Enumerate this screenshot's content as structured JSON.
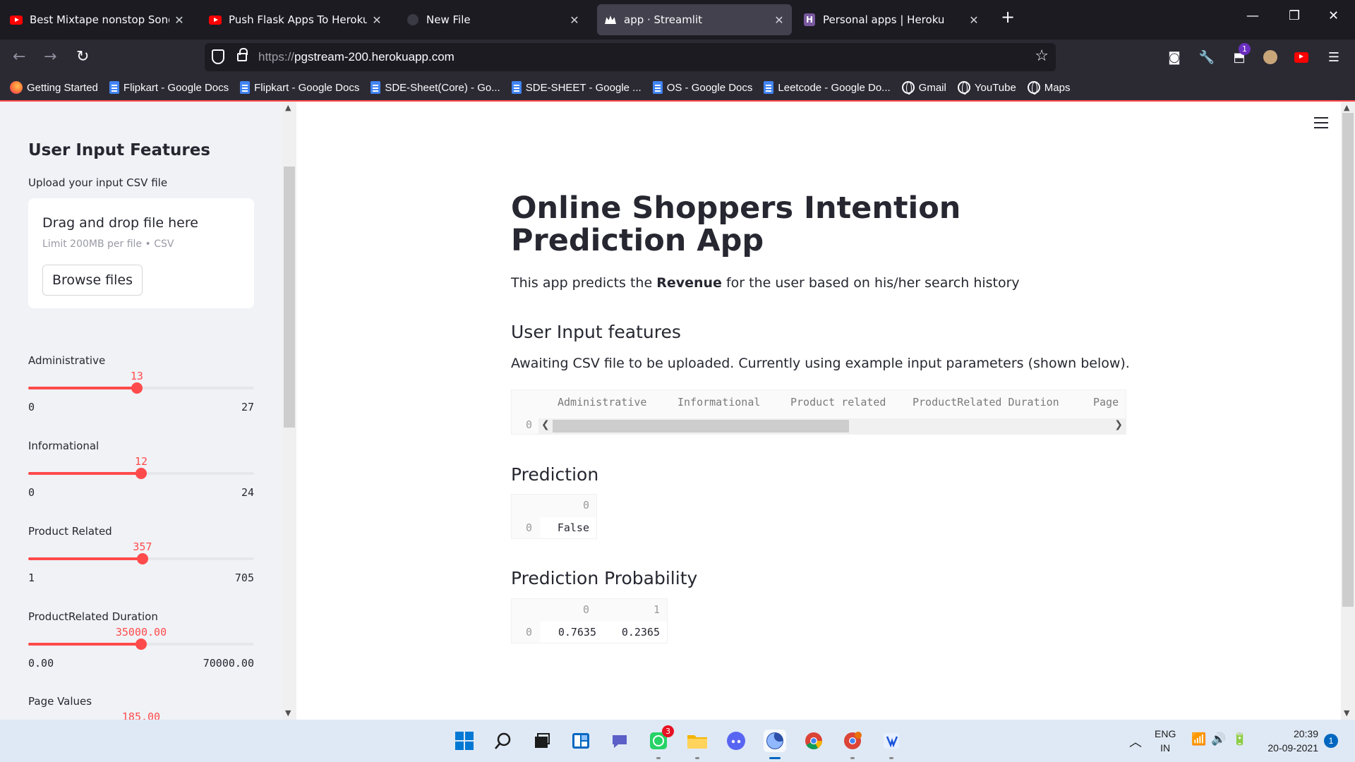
{
  "browser": {
    "tabs": [
      {
        "title": "Best Mixtape nonstop Songs | B",
        "icon": "youtube-icon",
        "active": false
      },
      {
        "title": "Push Flask Apps To Heroku For V",
        "icon": "youtube-icon",
        "active": false
      },
      {
        "title": "New File",
        "icon": "github-icon",
        "active": false
      },
      {
        "title": "app · Streamlit",
        "icon": "streamlit-icon",
        "active": true
      },
      {
        "title": "Personal apps | Heroku",
        "icon": "heroku-icon",
        "active": false
      }
    ],
    "url_protocol": "https://",
    "url_host": "pgstream-200.herokuapp.com",
    "bookmarks": [
      {
        "label": "Getting Started",
        "icon": "firefox-icon"
      },
      {
        "label": "Flipkart - Google Docs",
        "icon": "google-docs-icon"
      },
      {
        "label": "Flipkart - Google Docs",
        "icon": "google-docs-icon"
      },
      {
        "label": "SDE-Sheet(Core) - Go...",
        "icon": "google-docs-icon"
      },
      {
        "label": "SDE-SHEET - Google ...",
        "icon": "google-docs-icon"
      },
      {
        "label": "OS - Google Docs",
        "icon": "google-docs-icon"
      },
      {
        "label": "Leetcode - Google Do...",
        "icon": "google-docs-icon"
      },
      {
        "label": "Gmail",
        "icon": "globe-icon"
      },
      {
        "label": "YouTube",
        "icon": "globe-icon"
      },
      {
        "label": "Maps",
        "icon": "globe-icon"
      }
    ],
    "extension_badge": "1"
  },
  "sidebar": {
    "title": "User Input Features",
    "upload_label": "Upload your input CSV file",
    "dropzone_title": "Drag and drop file here",
    "dropzone_limit": "Limit 200MB per file • CSV",
    "browse_button": "Browse files",
    "sliders": [
      {
        "label": "Administrative",
        "value": "13",
        "min": "0",
        "max": "27",
        "fraction": 0.481
      },
      {
        "label": "Informational",
        "value": "12",
        "min": "0",
        "max": "24",
        "fraction": 0.5
      },
      {
        "label": "Product Related",
        "value": "357",
        "min": "1",
        "max": "705",
        "fraction": 0.506
      },
      {
        "label": "ProductRelated Duration",
        "value": "35000.00",
        "min": "0.00",
        "max": "70000.00",
        "fraction": 0.5
      },
      {
        "label": "Page Values",
        "value": "185.00",
        "min": "",
        "max": "",
        "fraction": 0.5
      }
    ]
  },
  "main": {
    "title": "Online Shoppers Intention Prediction App",
    "intro_prefix": "This app predicts the ",
    "intro_bold": "Revenue",
    "intro_suffix": " for the user based on his/her search history",
    "user_input_heading": "User Input features",
    "awaiting_text": "Awaiting CSV file to be uploaded. Currently using example input parameters (shown below).",
    "input_table": {
      "columns": [
        "Administrative",
        "Informational",
        "Product related",
        "ProductRelated Duration",
        "Page"
      ],
      "row_index": "0"
    },
    "prediction_heading": "Prediction",
    "prediction_table": {
      "column": "0",
      "row_index": "0",
      "value": "False"
    },
    "probability_heading": "Prediction Probability",
    "probability_table": {
      "columns": [
        "0",
        "1"
      ],
      "row_index": "0",
      "values": [
        "0.7635",
        "0.2365"
      ]
    }
  },
  "taskbar": {
    "whatsapp_badge": "3",
    "language": "ENG",
    "region": "IN",
    "time": "20:39",
    "date": "20-09-2021",
    "notification_count": "1"
  }
}
